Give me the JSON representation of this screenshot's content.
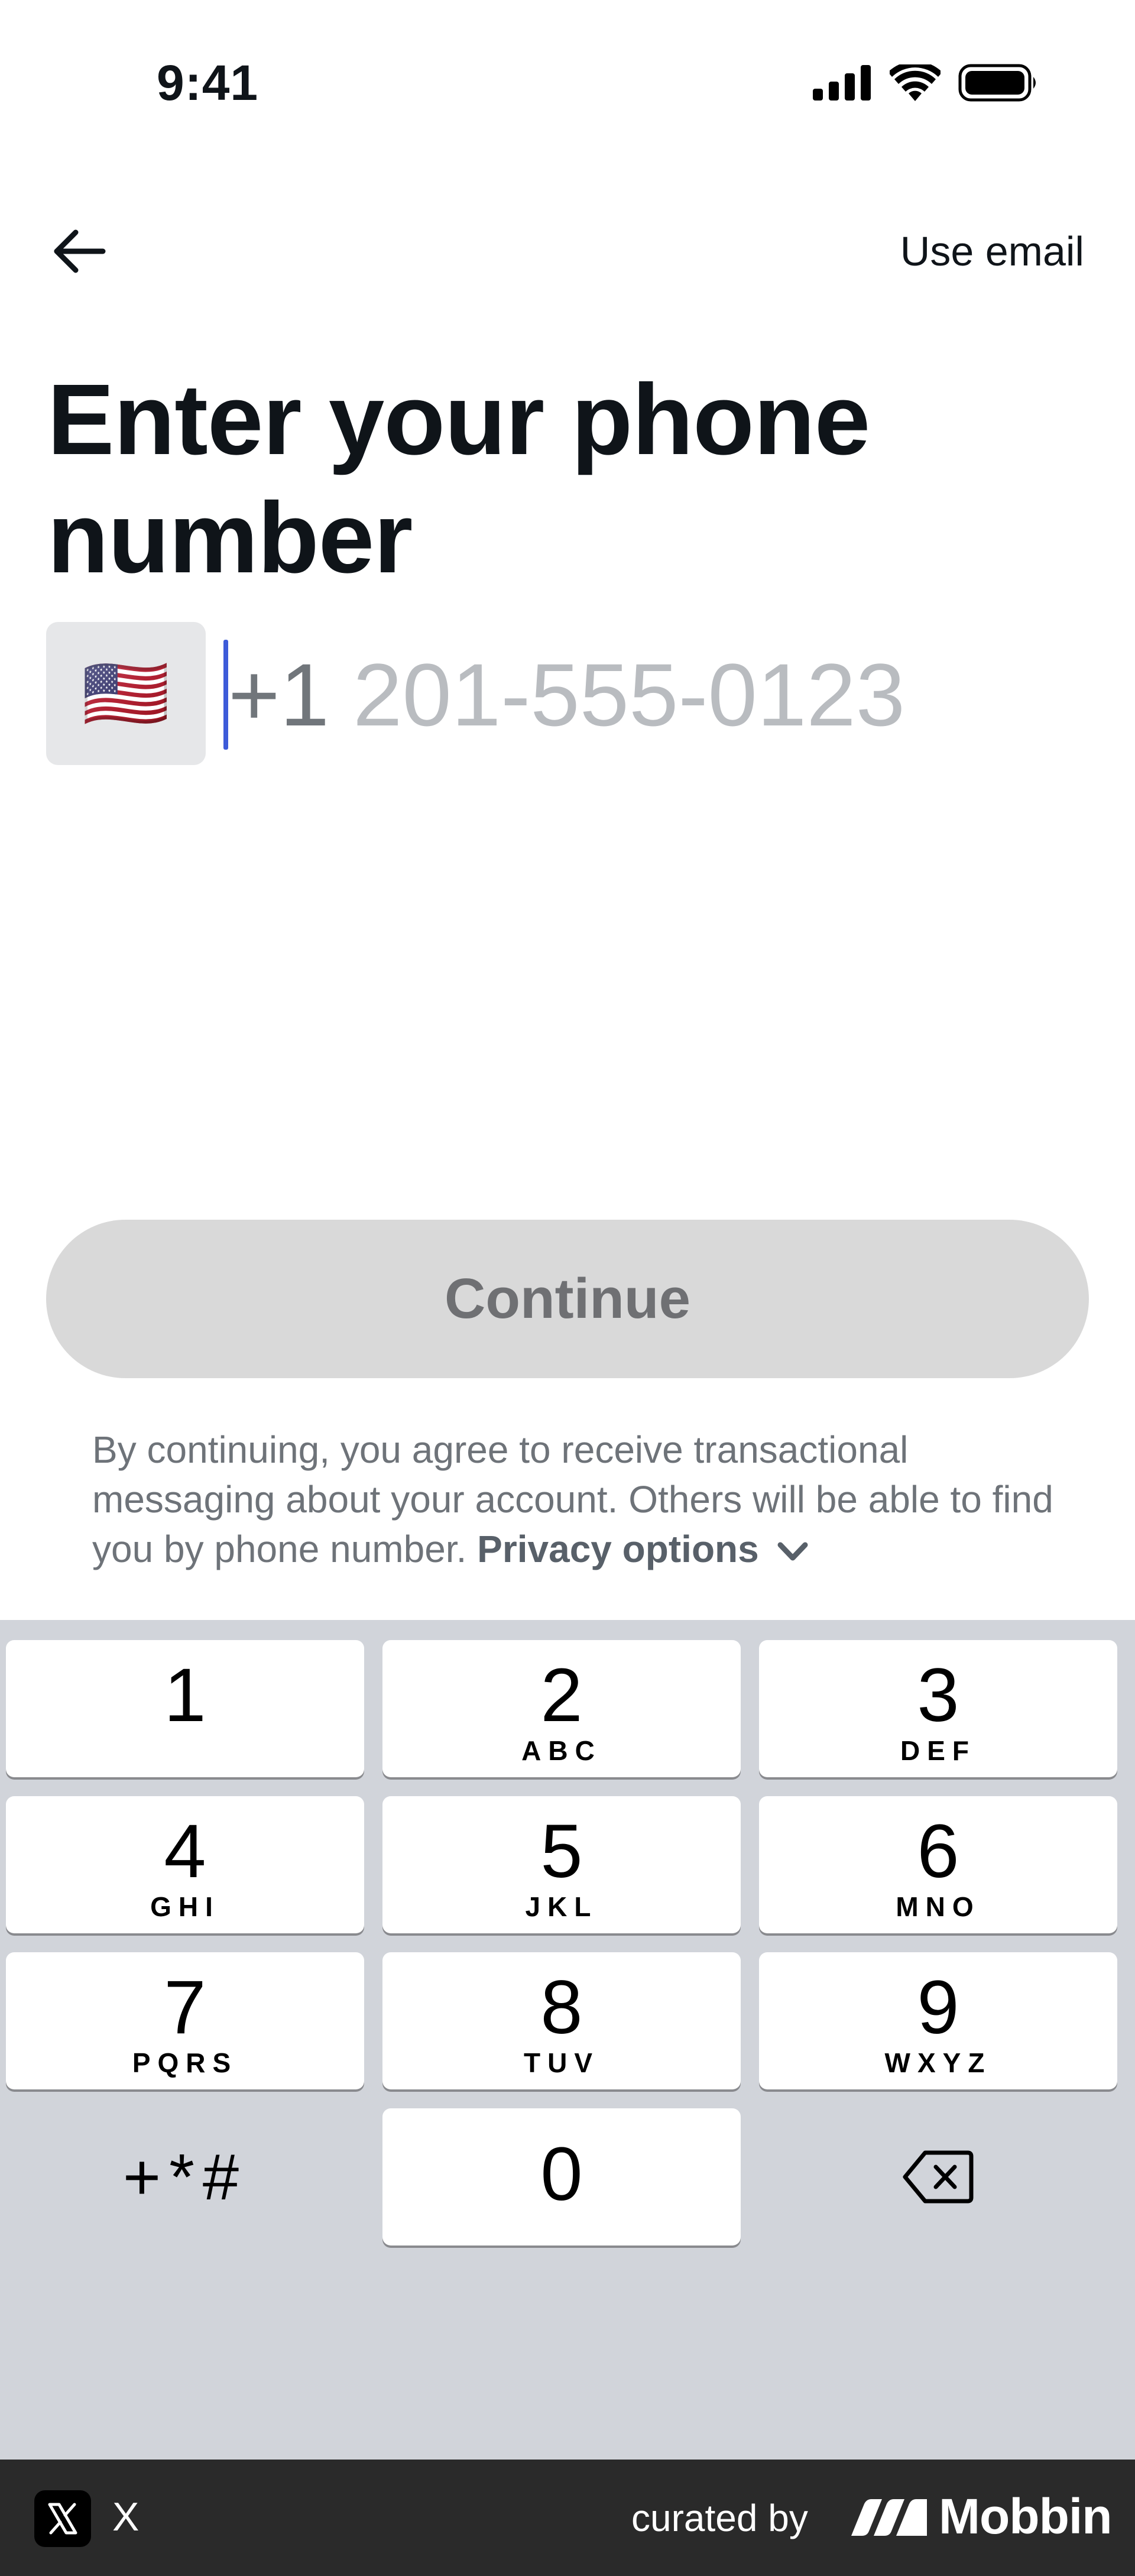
{
  "status_bar": {
    "time": "9:41"
  },
  "nav": {
    "use_email_label": "Use email"
  },
  "title": "Enter your phone number",
  "phone": {
    "flag": "🇺🇸",
    "dial_code": "+1",
    "placeholder": "201-555-0123"
  },
  "continue_label": "Continue",
  "legal": {
    "text": "By continuing, you agree to receive transactional messaging about your account. Others will be able to find you by phone number.",
    "privacy_label": "Privacy options"
  },
  "keypad": {
    "keys": [
      {
        "num": "1",
        "letters": ""
      },
      {
        "num": "2",
        "letters": "ABC"
      },
      {
        "num": "3",
        "letters": "DEF"
      },
      {
        "num": "4",
        "letters": "GHI"
      },
      {
        "num": "5",
        "letters": "JKL"
      },
      {
        "num": "6",
        "letters": "MNO"
      },
      {
        "num": "7",
        "letters": "PQRS"
      },
      {
        "num": "8",
        "letters": "TUV"
      },
      {
        "num": "9",
        "letters": "WXYZ"
      },
      {
        "num": "0",
        "letters": ""
      }
    ],
    "symbols": "+*#"
  },
  "footer": {
    "app_name": "X",
    "curated_by": "curated by",
    "brand": "Mobbin"
  },
  "colors": {
    "caret": "#3d5bd9",
    "keypad_bg": "#d1d4da",
    "button_disabled": "#d9d9d9",
    "footer_bg": "#2a2a2a"
  }
}
